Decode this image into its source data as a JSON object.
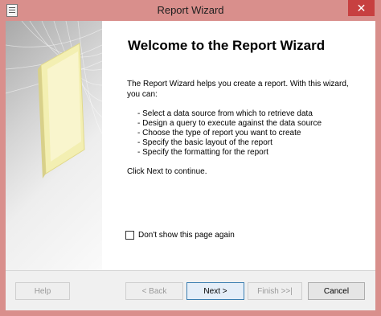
{
  "window": {
    "title": "Report Wizard",
    "close_glyph": "✕"
  },
  "page": {
    "heading": "Welcome to the Report Wizard",
    "intro": "The Report Wizard helps you create a report. With this wizard, you can:",
    "steps": [
      "- Select a data source from which to retrieve data",
      "- Design a query to execute against the data source",
      "- Choose the type of report you want to create",
      "- Specify the basic layout of the report",
      "- Specify the formatting for the report"
    ],
    "continue_note": "Click Next to continue.",
    "dont_show_label": "Don't show this page again",
    "dont_show_checked": false
  },
  "buttons": {
    "help": "Help",
    "back": "< Back",
    "next": "Next >",
    "finish": "Finish >>|",
    "cancel": "Cancel"
  },
  "colors": {
    "titlebar": "#d98f8c",
    "close": "#c74040",
    "panel": "#f0f0f0"
  }
}
